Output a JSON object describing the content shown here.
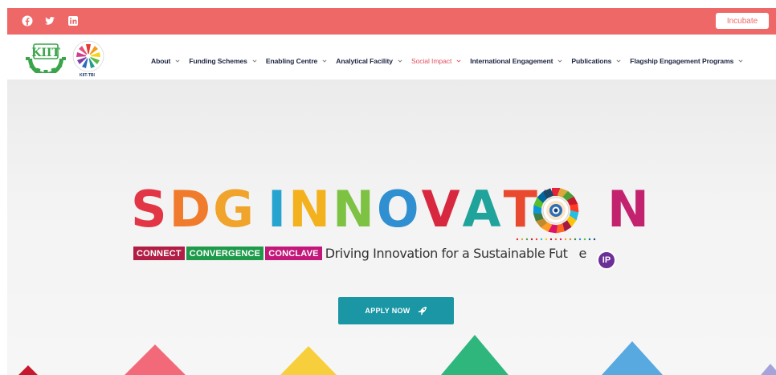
{
  "topbar": {
    "social_icons": [
      "facebook-icon",
      "twitter-icon",
      "linkedin-icon"
    ],
    "incubate_label": "Incubate",
    "color": "#ee6868"
  },
  "nav": {
    "logo_caption": "KIIT-TBI",
    "menu": [
      {
        "label": "About",
        "active": false
      },
      {
        "label": "Funding Schemes",
        "active": false
      },
      {
        "label": "Enabling Centre",
        "active": false
      },
      {
        "label": "Analytical Facility",
        "active": false
      },
      {
        "label": "Social Impact",
        "active": true
      },
      {
        "label": "International Engagement",
        "active": false
      },
      {
        "label": "Publications",
        "active": false
      },
      {
        "label": "Flagship Engagement Programs",
        "active": false
      }
    ]
  },
  "hero": {
    "title_letters": [
      "S",
      "D",
      "G",
      " ",
      "I",
      "N",
      "N",
      "O",
      "V",
      "A",
      "T",
      "I",
      "",
      "N"
    ],
    "tags": [
      "CONNECT",
      "CONVERGENCE",
      "CONCLAVE"
    ],
    "tagline": "Driving Innovation for a Sustainable Fut",
    "tagline_end": "e",
    "ip_badge": "IP",
    "apply_label": "APPLY NOW",
    "colors": {
      "tag_connect": "#b01e45",
      "tag_convergence": "#1e9a4b",
      "tag_conclave": "#c2187a",
      "apply_button": "#1a96a4"
    }
  }
}
